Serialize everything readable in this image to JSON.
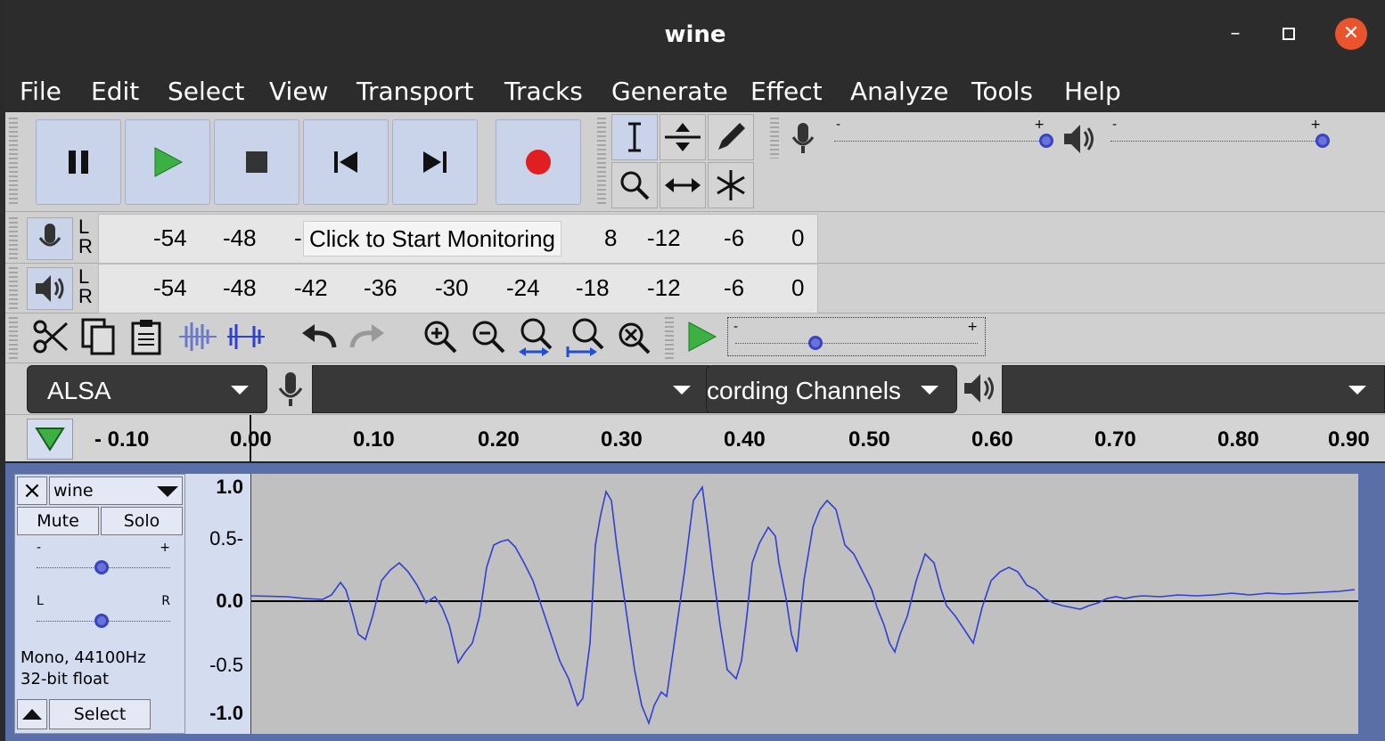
{
  "window": {
    "title": "wine"
  },
  "menu": [
    "File",
    "Edit",
    "Select",
    "View",
    "Transport",
    "Tracks",
    "Generate",
    "Effect",
    "Analyze",
    "Tools",
    "Help"
  ],
  "meters": {
    "record_scale": [
      "-54",
      "-48",
      "-",
      "8",
      "-12",
      "-6",
      "0"
    ],
    "record_tooltip": "Click to Start Monitoring",
    "play_scale": [
      "-54",
      "-48",
      "-42",
      "-36",
      "-30",
      "-24",
      "-18",
      "-12",
      "-6",
      "0"
    ],
    "l": "L",
    "r": "R"
  },
  "sliders": {
    "minus": "-",
    "plus": "+",
    "record_volume": 1.0,
    "playback_volume": 1.0,
    "play_speed": 0.36
  },
  "device": {
    "host": "ALSA",
    "recording_device": "",
    "recording_channels": "cording Channels",
    "playback_device": ""
  },
  "ruler": {
    "ticks": [
      "- 0.10",
      "0.00",
      "0.10",
      "0.20",
      "0.30",
      "0.40",
      "0.50",
      "0.60",
      "0.70",
      "0.80",
      "0.90"
    ]
  },
  "track": {
    "name": "wine",
    "mute": "Mute",
    "solo": "Solo",
    "gain_minus": "-",
    "gain_plus": "+",
    "pan_l": "L",
    "pan_r": "R",
    "info1": "Mono, 44100Hz",
    "info2": "32-bit float",
    "select": "Select",
    "close": "×",
    "gain_level": 0.5,
    "pan_level": 0.5,
    "vscale": [
      "1.0",
      "0.5-",
      "0.0",
      "-0.5",
      "-1.0"
    ]
  },
  "colors": {
    "waveform": "#3040d0",
    "record": "#e02020",
    "play": "#3cb043"
  }
}
